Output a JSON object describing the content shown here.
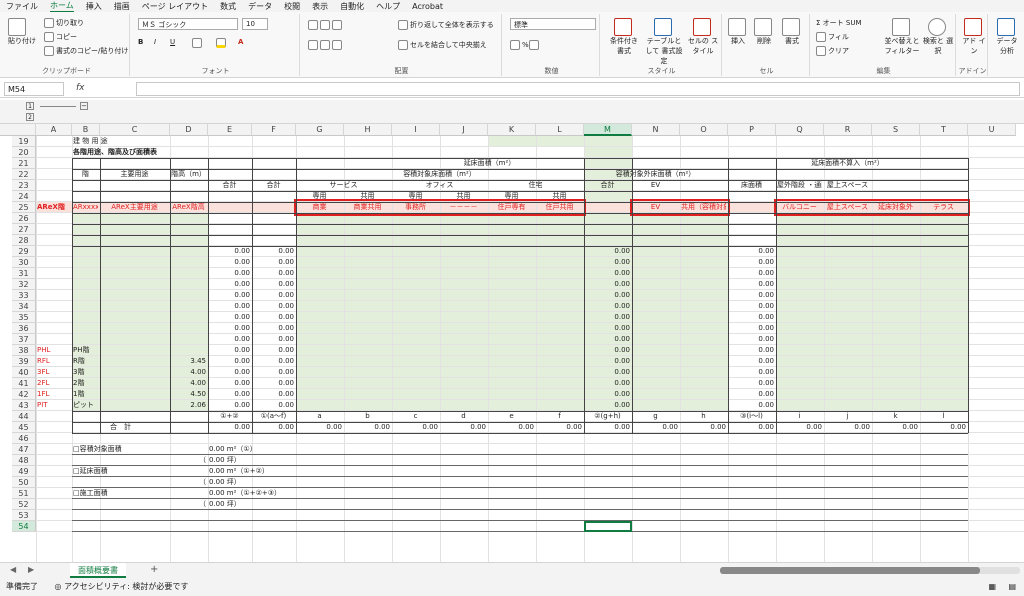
{
  "menu": [
    "ファイル",
    "ホーム",
    "挿入",
    "描画",
    "ページ レイアウト",
    "数式",
    "データ",
    "校閲",
    "表示",
    "自動化",
    "ヘルプ",
    "Acrobat"
  ],
  "menu_active": 1,
  "ribbon": {
    "paste": "貼り付け",
    "cut": "切り取り",
    "copy": "コピー",
    "format_painter": "書式のコピー/貼り付け",
    "clipboard": "クリップボード",
    "font_name": "ＭＳ ゴシック",
    "font_size": "10",
    "font": "フォント",
    "wrap": "折り返して全体を表示する",
    "merge": "セルを結合して中央揃え",
    "alignment": "配置",
    "number_format": "標準",
    "number": "数値",
    "conditional": "条件付き 書式",
    "table": "テーブルとして 書式設定",
    "cellstyle": "セルの スタイル",
    "style": "スタイル",
    "insert": "挿入",
    "delete": "削除",
    "format": "書式",
    "cells": "セル",
    "autosum": "オート SUM",
    "fill": "フィル",
    "clear": "クリア",
    "sort": "並べ替えと フィルター",
    "find": "検索と 選択",
    "editing": "編集",
    "addin": "アド イン",
    "addin_group": "アドイン",
    "analyze": "データ 分析"
  },
  "formula": {
    "namebox": "M54",
    "fx": "fx"
  },
  "columns": [
    "A",
    "B",
    "C",
    "D",
    "E",
    "F",
    "G",
    "H",
    "I",
    "J",
    "K",
    "L",
    "M",
    "N",
    "O",
    "P",
    "Q",
    "R",
    "S",
    "T",
    "U"
  ],
  "rows": [
    "19",
    "20",
    "21",
    "22",
    "23",
    "24",
    "25",
    "26",
    "27",
    "28",
    "29",
    "30",
    "31",
    "32",
    "33",
    "34",
    "35",
    "36",
    "37",
    "38",
    "39",
    "40",
    "41",
    "42",
    "43",
    "44",
    "45",
    "46",
    "47",
    "48",
    "49",
    "50",
    "51",
    "52",
    "53",
    "54"
  ],
  "sheet": {
    "row19": "建 物 用 途",
    "title": "各階用途、階高及び面積表",
    "h_floor": "階",
    "h_use": "主要用途",
    "h_height": "階高（m）",
    "h_total": "合計",
    "h_enobe": "延床面積（m²）",
    "h_youseki": "容積対象床面積（m²）",
    "h_gokei": "合計",
    "h_service": "サービス",
    "h_office": "オフィス",
    "h_jutaku": "住宅",
    "h_senyo": "専用",
    "h_kyoyo": "共用",
    "h_yosekigai": "容積対象外床面積（m²）",
    "h_ev": "EV",
    "h_yukamenseki": "床面積",
    "h_fusan": "延床面積不算入（m²）",
    "h_okugai": "屋外階段 ・通路",
    "h_okujo": "屋上スペース",
    "r25": {
      "a": "AReX階",
      "b": "ARxxxxx",
      "c": "AReX主要用途",
      "d": "AReX階高",
      "g": "商業",
      "h": "商業共用",
      "i": "事務所",
      "j": "－－－－",
      "k": "住戸専有",
      "l": "住戸共用",
      "n": "EV",
      "o": "共用（容積対象外）",
      "q": "バルコニー",
      "r": "屋上スペース",
      "s": "延床対象外",
      "t": "テラス"
    },
    "zero": "0.00",
    "floors": [
      {
        "a": "PHL",
        "b": "PH階",
        "d": ""
      },
      {
        "a": "RFL",
        "b": "R階",
        "d": "3.45"
      },
      {
        "a": "3FL",
        "b": "3階",
        "d": "4.00"
      },
      {
        "a": "2FL",
        "b": "2階",
        "d": "4.00"
      },
      {
        "a": "1FL",
        "b": "1階",
        "d": "4.50"
      },
      {
        "a": "PIT",
        "b": "ピット",
        "d": "2.06"
      }
    ],
    "r44": {
      "e": "①+②",
      "f": "①(a～f)",
      "g": "a",
      "h": "b",
      "i": "c",
      "j": "d",
      "k": "e",
      "l": "f",
      "m": "②(g+h)",
      "n": "g",
      "o": "h",
      "p": "③(i～l)",
      "q": "i",
      "r": "j",
      "s": "k",
      "t": "l"
    },
    "r45": "合　計",
    "r47": "□容積対象面積",
    "r47v": "0.00 m²（①）",
    "r48": "（",
    "r48v": "0.00 坪）",
    "r49": "□延床面積",
    "r49v": "0.00 m²（①+②）",
    "r50": "（",
    "r50v": "0.00 坪）",
    "r51": "□施工面積",
    "r51v": "0.00 m²（①+②+③）",
    "r52": "（",
    "r52v": "0.00 坪）"
  },
  "sheet_tab": "面積概要書",
  "add_sheet": "+",
  "status": {
    "ready": "準備完了",
    "accessibility": "アクセシビリティ: 検討が必要です"
  }
}
